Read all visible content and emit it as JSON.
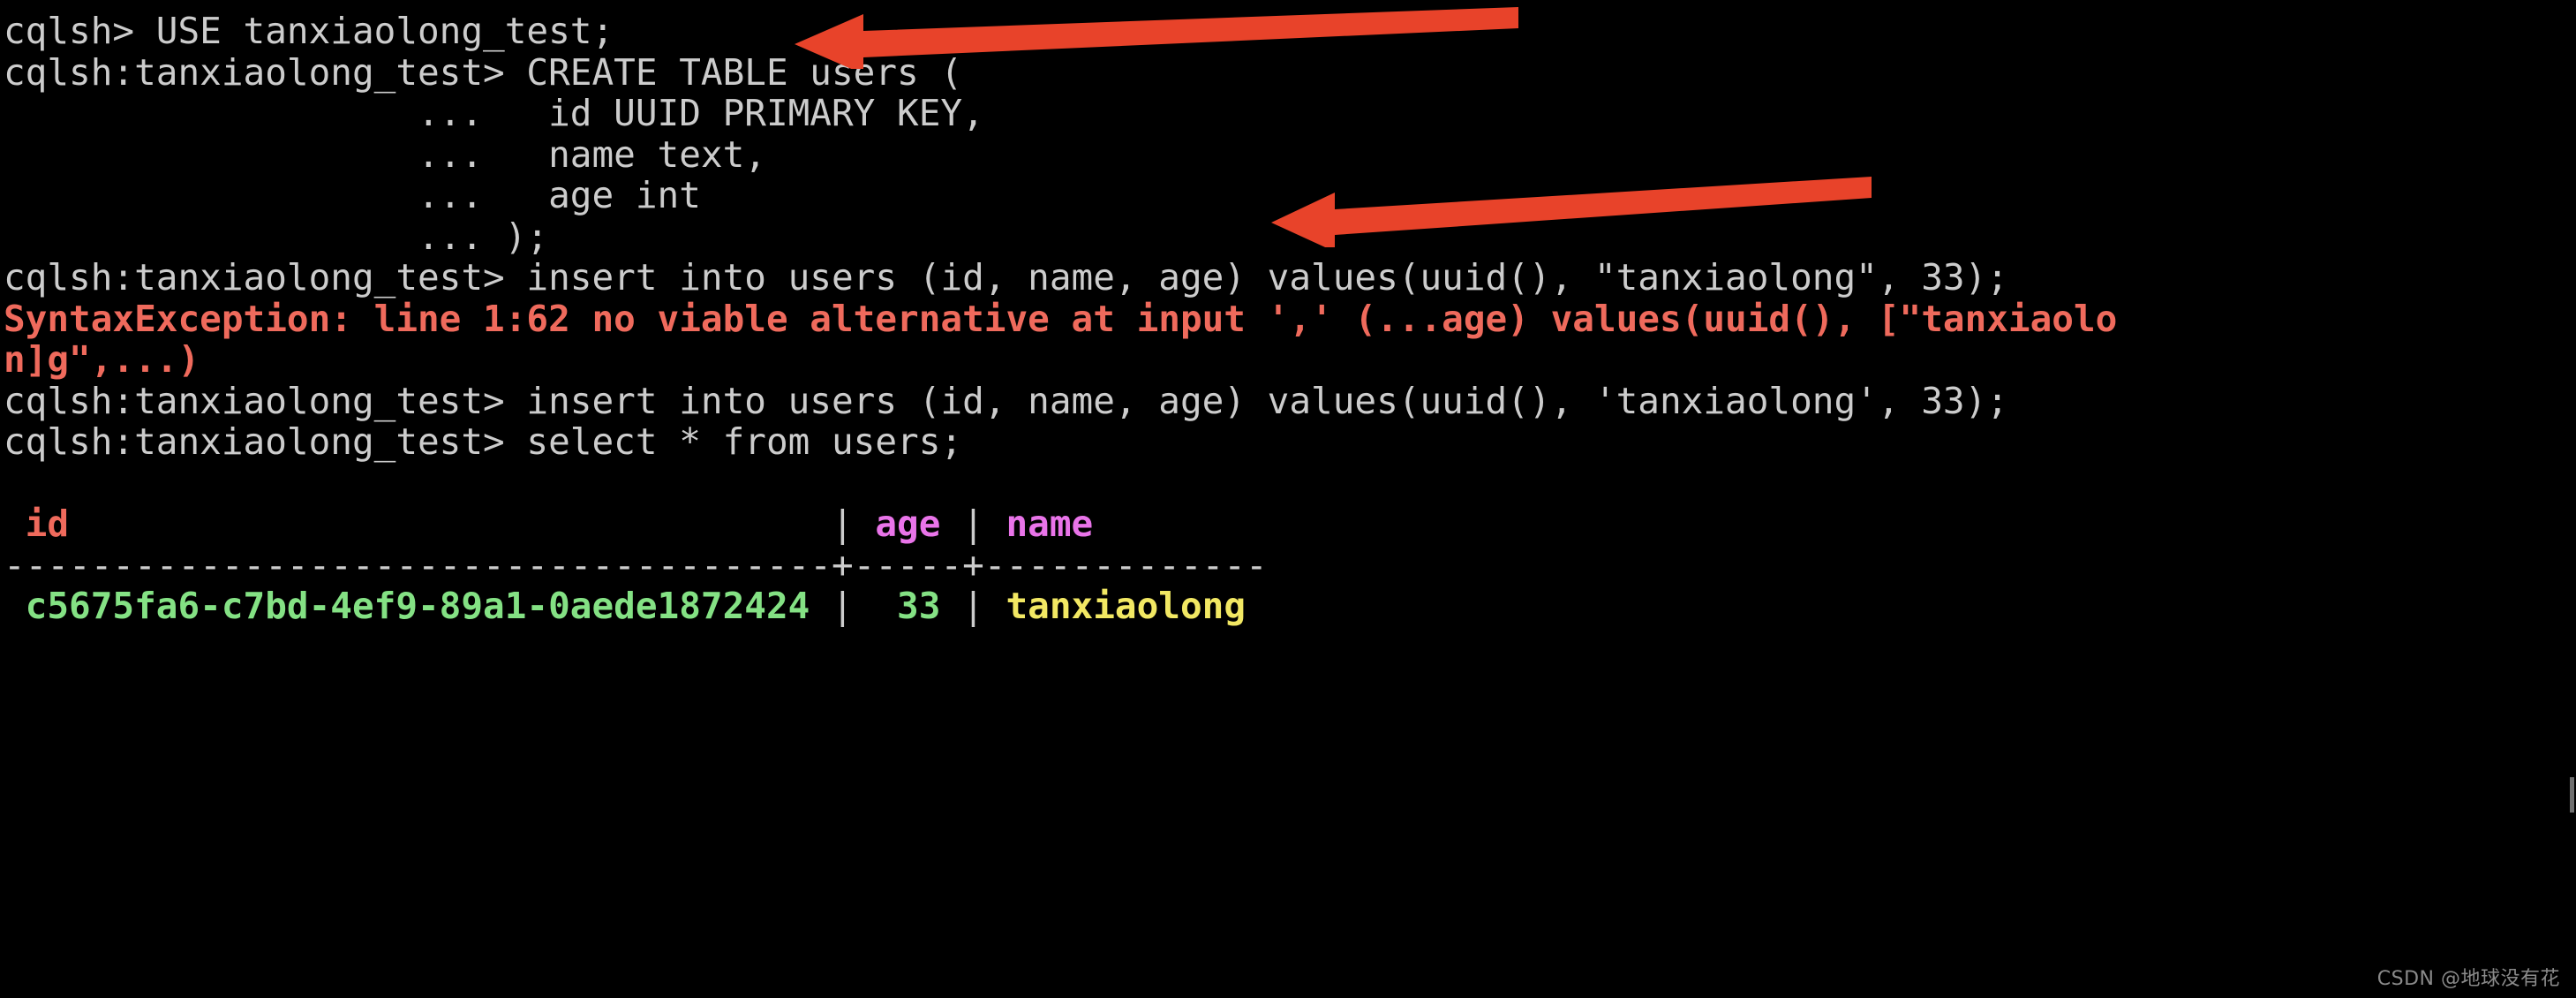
{
  "terminal": {
    "background_color": "#000000",
    "default_text_color": "#cccccc",
    "error_color": "#ef6a5c",
    "column_header_color": "#e974e9",
    "uuid_value_color": "#84e184",
    "int_value_color": "#84e184",
    "text_value_color": "#f2e863",
    "lines": {
      "l01": "cqlsh> USE tanxiaolong_test;",
      "l02": "cqlsh:tanxiaolong_test> CREATE TABLE users (",
      "l03": "                   ...   id UUID PRIMARY KEY,",
      "l04": "                   ...   name text,",
      "l05": "                   ...   age int",
      "l06": "                   ... );",
      "l07": "cqlsh:tanxiaolong_test> insert into users (id, name, age) values(uuid(), \"tanxiaolong\", 33);",
      "l08": "SyntaxException: line 1:62 no viable alternative at input ',' (...age) values(uuid(), [\"tanxiaolo",
      "l09": "n]g\",...)",
      "l10": "cqlsh:tanxiaolong_test> insert into users (id, name, age) values(uuid(), 'tanxiaolong', 33);",
      "l11": "cqlsh:tanxiaolong_test> select * from users;"
    },
    "result_table": {
      "header": {
        "id": " id",
        "pipe1": "                                   | ",
        "age": "age",
        "pipe2": " | ",
        "name": "name"
      },
      "separator": "--------------------------------------+-----+-------------",
      "row": {
        "id": " c5675fa6-c7bd-4ef9-89a1-0aede1872424",
        "pipe1": " | ",
        "age": " 33",
        "pipe2": " | ",
        "name": "tanxiaolong"
      }
    }
  },
  "annotations": {
    "arrow_color": "#e8432a",
    "arrow1": {
      "name": "use-keyspace-arrow",
      "points_at": "cqlsh> USE tanxiaolong_test;"
    },
    "arrow2": {
      "name": "create-table-arrow",
      "points_at": "... name text,"
    }
  },
  "watermark": {
    "text": "CSDN @地球没有花"
  }
}
